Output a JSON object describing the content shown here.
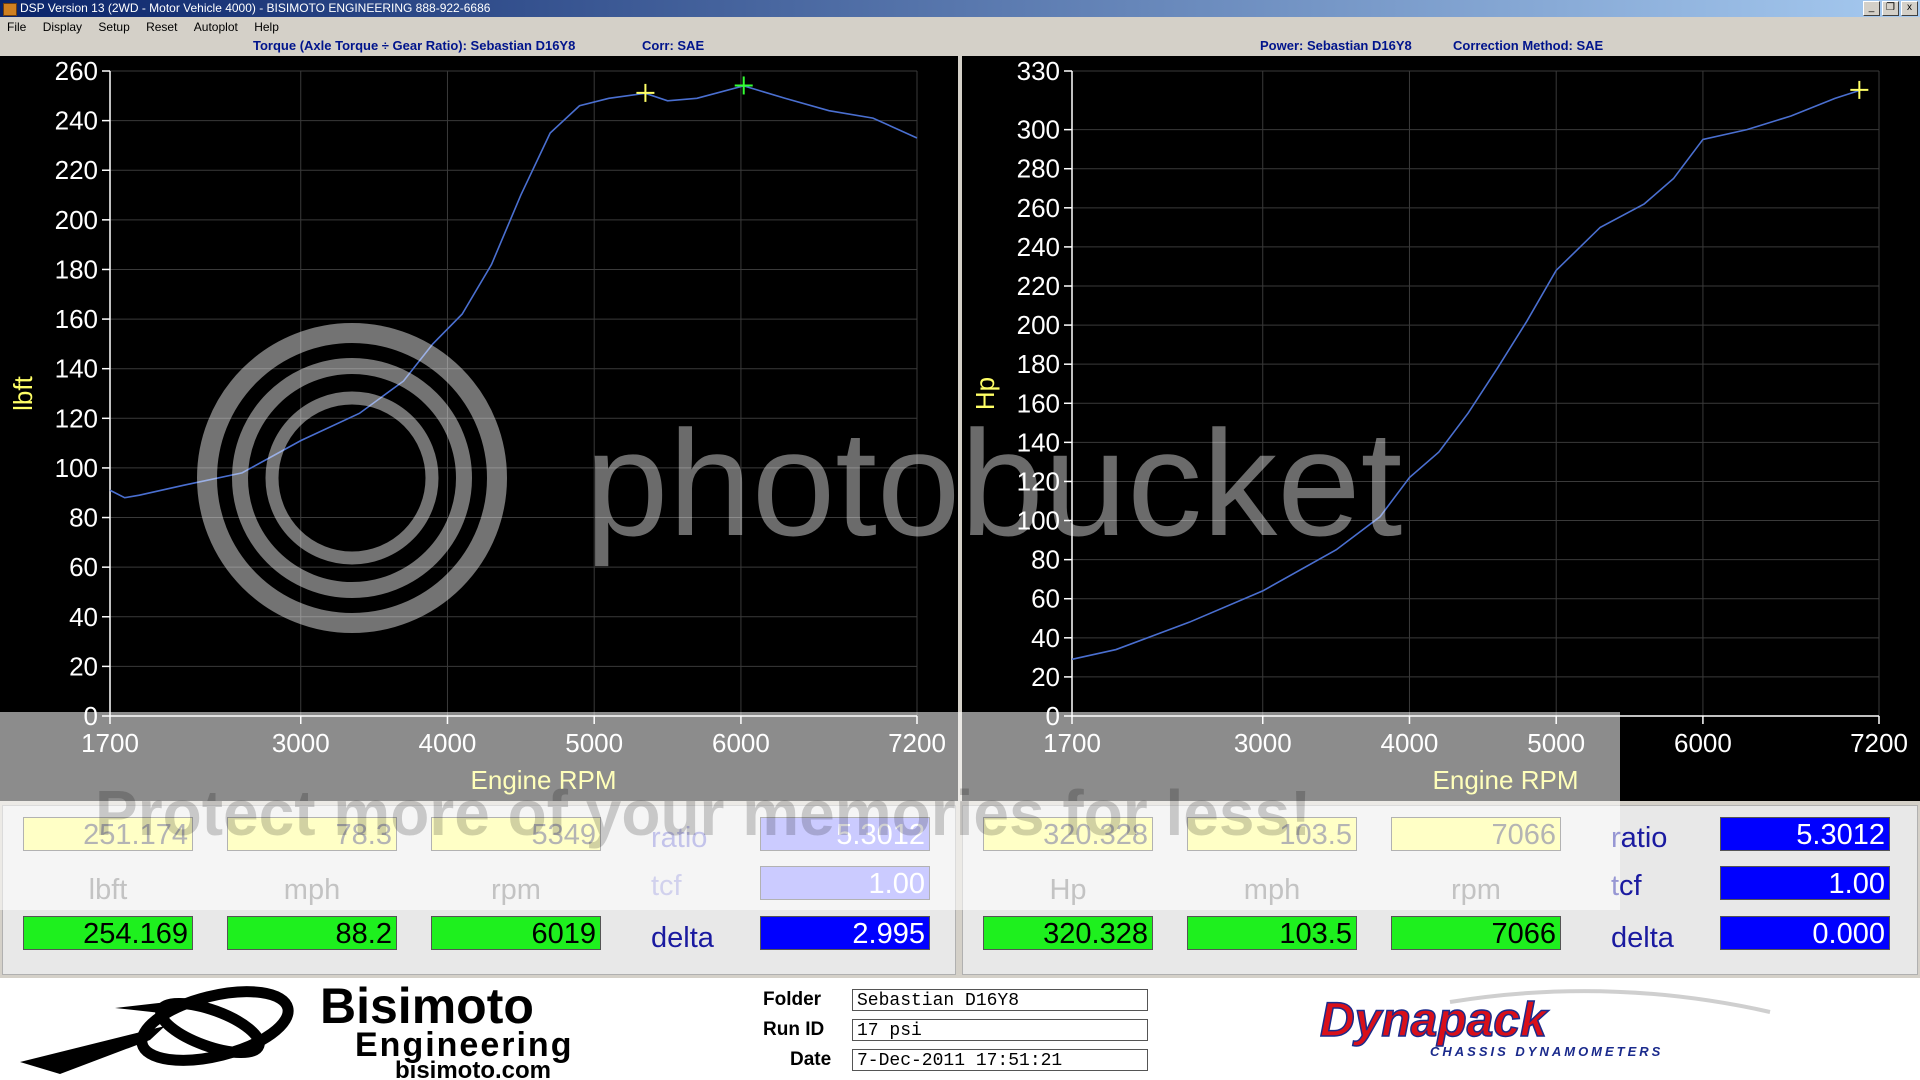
{
  "window": {
    "title": "DSP Version 13 (2WD - Motor Vehicle 4000) - BISIMOTO ENGINEERING 888-922-6686",
    "controls": [
      "_",
      "❐",
      "x"
    ]
  },
  "menu": [
    "File",
    "Display",
    "Setup",
    "Reset",
    "Autoplot",
    "Help"
  ],
  "left_panel": {
    "title_main": "Torque (Axle Torque ÷ Gear Ratio): Sebastian D16Y8",
    "title_corr": "Corr: SAE",
    "readout": {
      "cursor1": {
        "value": "251.174",
        "speed": "78.3",
        "rpm": "5349"
      },
      "units": {
        "value": "lbft",
        "speed": "mph",
        "rpm": "rpm"
      },
      "cursor2": {
        "value": "254.169",
        "speed": "88.2",
        "rpm": "6019"
      },
      "labels": {
        "ratio": "ratio",
        "tcf": "tcf",
        "delta": "delta"
      },
      "ratio": "5.3012",
      "tcf": "1.00",
      "delta": "2.995"
    }
  },
  "right_panel": {
    "title_main": "Power: Sebastian D16Y8",
    "title_corr": "Correction Method: SAE",
    "readout": {
      "cursor1": {
        "value": "320.328",
        "speed": "103.5",
        "rpm": "7066"
      },
      "units": {
        "value": "Hp",
        "speed": "mph",
        "rpm": "rpm"
      },
      "cursor2": {
        "value": "320.328",
        "speed": "103.5",
        "rpm": "7066"
      },
      "labels": {
        "ratio": "ratio",
        "tcf": "tcf",
        "delta": "delta"
      },
      "ratio": "5.3012",
      "tcf": "1.00",
      "delta": "0.000"
    }
  },
  "footer": {
    "logo": {
      "name": "Bisimoto",
      "sub": "Engineering",
      "url": "bisimoto.com"
    },
    "folder_label": "Folder",
    "folder": "Sebastian D16Y8",
    "runid_label": "Run ID",
    "runid": "17 psi",
    "date_label": "Date",
    "date": "7-Dec-2011 17:51:21",
    "brand": "Dynapack",
    "brand_sub": "CHASSIS DYNAMOMETERS"
  },
  "watermark": {
    "text": "photobucket",
    "banner": "Protect more of your memories for less!"
  },
  "colors": {
    "curve": "#4a6fd0",
    "axis_text": "#ffffff",
    "axis_label": "#ffff66",
    "plot_bg": "#000000"
  },
  "chart_data": [
    {
      "type": "line",
      "xlabel": "Engine RPM",
      "ylabel": "lbft",
      "xlim": [
        1700,
        7200
      ],
      "ylim": [
        0,
        260
      ],
      "xticks": [
        1700,
        3000,
        4000,
        5000,
        6000,
        7200
      ],
      "yticks": [
        0,
        20,
        40,
        60,
        80,
        100,
        120,
        140,
        160,
        180,
        200,
        220,
        240,
        260
      ],
      "grid": true,
      "series": [
        {
          "x": [
            1700,
            1800,
            1900,
            2200,
            2600,
            3000,
            3400,
            3700,
            3900,
            4100,
            4300,
            4500,
            4700,
            4900,
            5100,
            5349,
            5500,
            5700,
            6019,
            6300,
            6600,
            6900,
            7200
          ],
          "y": [
            91,
            88,
            89,
            93,
            98,
            111,
            122,
            135,
            150,
            162,
            182,
            210,
            235,
            246,
            249,
            251,
            248,
            249,
            254,
            249,
            244,
            241,
            233
          ]
        }
      ],
      "markers": [
        {
          "x": 5349,
          "y": 251.174
        },
        {
          "x": 6019,
          "y": 254.169
        }
      ]
    },
    {
      "type": "line",
      "xlabel": "Engine RPM",
      "ylabel": "Hp",
      "xlim": [
        1700,
        7200
      ],
      "ylim": [
        0,
        330
      ],
      "xticks": [
        1700,
        3000,
        4000,
        5000,
        6000,
        7200
      ],
      "yticks": [
        0,
        20,
        40,
        60,
        80,
        100,
        120,
        140,
        160,
        180,
        200,
        220,
        240,
        260,
        280,
        300,
        330
      ],
      "grid": true,
      "series": [
        {
          "x": [
            1700,
            2000,
            2500,
            3000,
            3500,
            3800,
            4000,
            4200,
            4400,
            4600,
            4800,
            5000,
            5300,
            5600,
            5800,
            6000,
            6300,
            6600,
            6900,
            7066
          ],
          "y": [
            29,
            34,
            48,
            64,
            85,
            102,
            122,
            135,
            155,
            178,
            202,
            228,
            250,
            262,
            275,
            295,
            300,
            307,
            316,
            320
          ]
        }
      ],
      "markers": [
        {
          "x": 7066,
          "y": 320.328
        }
      ]
    }
  ]
}
